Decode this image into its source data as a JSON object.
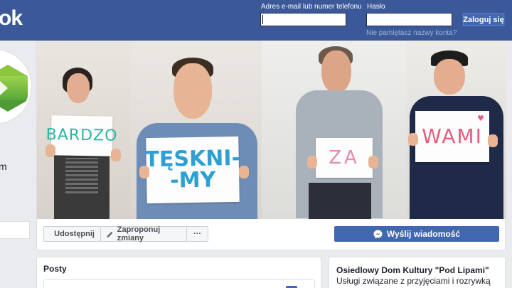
{
  "header": {
    "logo_fragment": "ok",
    "email_label": "Adres e-mail lub numer telefonu",
    "password_label": "Hasło",
    "email_value": "",
    "password_value": "",
    "login_button": "Zaloguj się",
    "forgot_link": "Nie pamiętasz nazwy konta?",
    "bar_color": "#3b5998"
  },
  "left_column": {
    "name_fragment": "m"
  },
  "cover": {
    "signs": [
      "BARDZO",
      "TĘSKNI-",
      "-MY",
      "ZA",
      "WAMI"
    ]
  },
  "actions": {
    "share": "Udostępnij",
    "suggest_edits": "Zaproponuj zmiany",
    "more": "···",
    "send_message": "Wyślij wiadomość"
  },
  "posts": {
    "title": "Posty"
  },
  "about": {
    "title": "Osiedlowy Dom Kultury \"Pod Lipami\"",
    "description": "Usługi związane z przyjęciami i rozrywką"
  },
  "icons": [
    "share-icon",
    "pencil-icon",
    "messenger-icon",
    "logo-hexagon-icon"
  ]
}
